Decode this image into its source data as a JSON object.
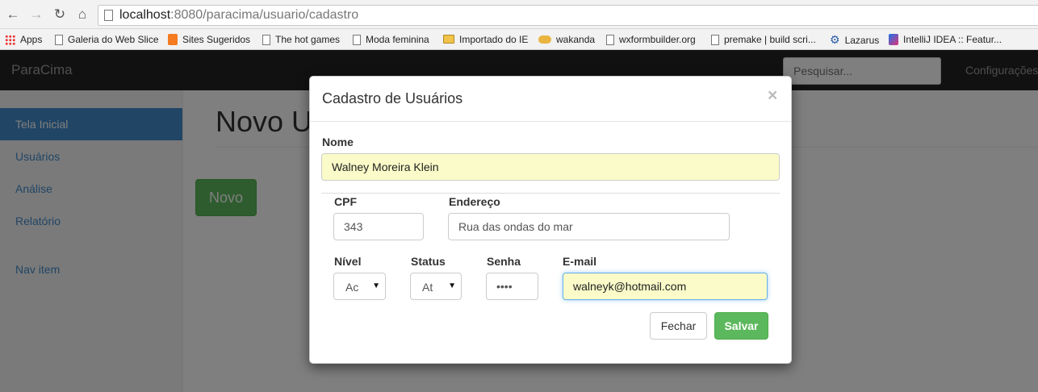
{
  "browser": {
    "url_host": "localhost",
    "url_path": ":8080/paracima/usuario/cadastro",
    "bookmarks": [
      {
        "label": "Apps",
        "icon": "apps-grid-icon"
      },
      {
        "label": "Galeria do Web Slice",
        "icon": "page-icon"
      },
      {
        "label": "Sites Sugeridos",
        "icon": "orange-bookmark-icon"
      },
      {
        "label": "The hot games",
        "icon": "page-icon"
      },
      {
        "label": "Moda feminina",
        "icon": "page-icon"
      },
      {
        "label": "Importado do IE",
        "icon": "folder-icon"
      },
      {
        "label": "wakanda",
        "icon": "handshake-icon"
      },
      {
        "label": "wxformbuilder.org",
        "icon": "page-icon"
      },
      {
        "label": "premake | build scri...",
        "icon": "page-icon"
      },
      {
        "label": "Lazarus",
        "icon": "gear-icon"
      },
      {
        "label": "IntelliJ IDEA :: Featur...",
        "icon": "intellij-icon"
      }
    ]
  },
  "navbar": {
    "brand": "ParaCima",
    "search_placeholder": "Pesquisar...",
    "config_label": "Configurações"
  },
  "sidebar": {
    "items": [
      {
        "label": "Tela Inicial",
        "active": true
      },
      {
        "label": "Usuários"
      },
      {
        "label": "Análise"
      },
      {
        "label": "Relatório"
      },
      {
        "label": "Nav item"
      }
    ]
  },
  "main": {
    "title": "Novo U",
    "novo_button": "Novo"
  },
  "modal": {
    "title": "Cadastro de Usuários",
    "close": "×",
    "nome_label": "Nome",
    "nome_value": "Walney Moreira Klein",
    "cpf_label": "CPF",
    "cpf_value": "343",
    "endereco_label": "Endereço",
    "endereco_value": "Rua das ondas do mar",
    "nivel_label": "Nível",
    "nivel_value": "Ac",
    "status_label": "Status",
    "status_value": "At",
    "senha_label": "Senha",
    "senha_value": "••••",
    "email_label": "E-mail",
    "email_value": "walneyk@hotmail.com",
    "fechar_label": "Fechar",
    "salvar_label": "Salvar"
  },
  "colors": {
    "primary": "#428bca",
    "success": "#5cb85c",
    "navbar": "#222222",
    "autofill": "#fafbc8"
  }
}
